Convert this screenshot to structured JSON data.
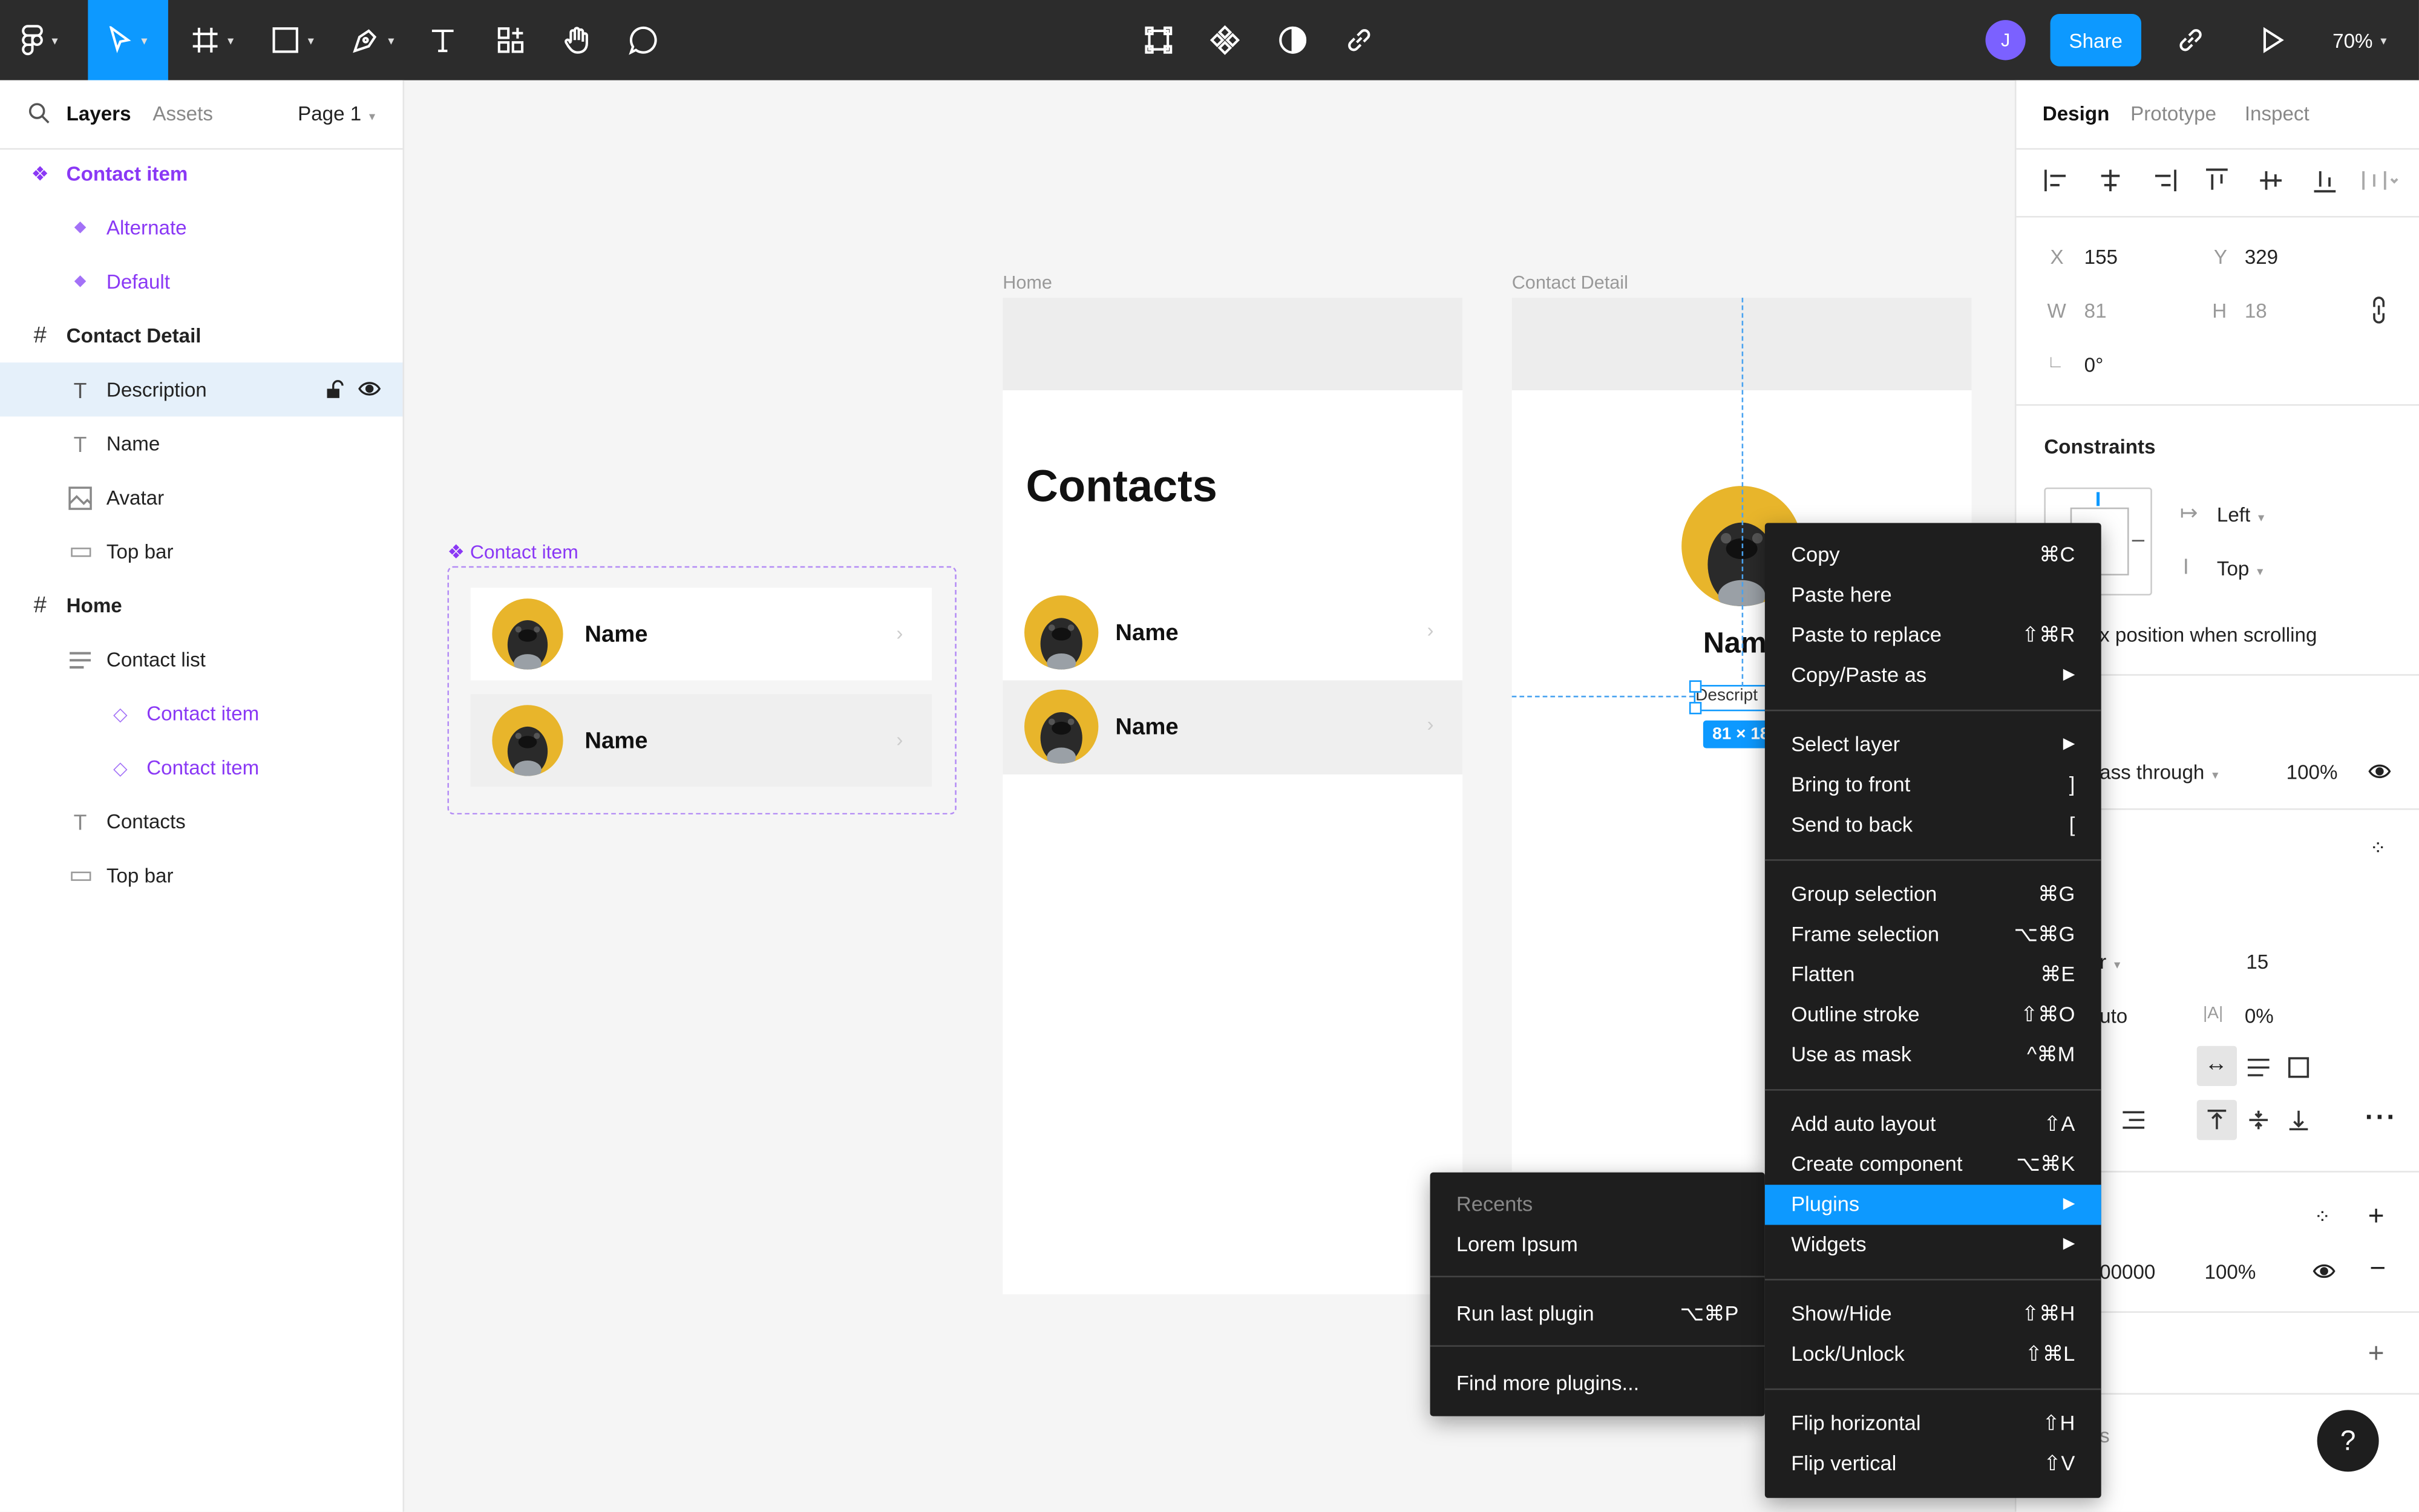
{
  "toolbar": {
    "share_label": "Share",
    "zoom": "70%",
    "avatar_initial": "J",
    "accent": "#0d99ff"
  },
  "left_panel": {
    "tabs": {
      "layers": "Layers",
      "assets": "Assets"
    },
    "page": "Page 1",
    "layers": [
      {
        "label": "Contact item",
        "icon": "component-icon"
      },
      {
        "label": "Alternate",
        "icon": "variant-icon"
      },
      {
        "label": "Default",
        "icon": "variant-icon"
      },
      {
        "label": "Contact Detail",
        "icon": "frame-icon"
      },
      {
        "label": "Description",
        "icon": "text-icon"
      },
      {
        "label": "Name",
        "icon": "text-icon"
      },
      {
        "label": "Avatar",
        "icon": "image-icon"
      },
      {
        "label": "Top bar",
        "icon": "rectangle-icon"
      },
      {
        "label": "Home",
        "icon": "frame-icon"
      },
      {
        "label": "Contact list",
        "icon": "auto-layout-icon"
      },
      {
        "label": "Contact item",
        "icon": "instance-icon"
      },
      {
        "label": "Contact item",
        "icon": "instance-icon"
      },
      {
        "label": "Contacts",
        "icon": "text-icon"
      },
      {
        "label": "Top bar",
        "icon": "rectangle-icon"
      }
    ]
  },
  "canvas": {
    "component_label": "Contact item",
    "home_label": "Home",
    "detail_label": "Contact Detail",
    "contacts_title": "Contacts",
    "row_name": "Name",
    "detail_name": "Name",
    "detail_desc": "Descript",
    "size_badge": "81 × 18"
  },
  "right_panel": {
    "tabs": {
      "design": "Design",
      "prototype": "Prototype",
      "inspect": "Inspect"
    },
    "x_label": "X",
    "x": "155",
    "y_label": "Y",
    "y": "329",
    "w_label": "W",
    "w": "81",
    "h_label": "H",
    "h": "18",
    "rotation": "0°",
    "constraints_title": "Constraints",
    "constraint_h": "Left",
    "constraint_v": "Top",
    "fix_position": "x position when scrolling",
    "blend": "ass through",
    "layer_opacity": "100%",
    "font_size": "15",
    "line_height": "uto",
    "letter_spacing_label": "|A|",
    "letter_spacing": "0%",
    "fill_hex": "00000",
    "fill_opacity": "100%",
    "effects_partial": "s",
    "font_weight_partial": "r"
  },
  "context_menu": {
    "items": [
      {
        "label": "Copy",
        "shortcut": "⌘C"
      },
      {
        "label": "Paste here",
        "shortcut": ""
      },
      {
        "label": "Paste to replace",
        "shortcut": "⇧⌘R"
      },
      {
        "label": "Copy/Paste as",
        "shortcut": "▶"
      },
      {
        "label": "Select layer",
        "shortcut": "▶"
      },
      {
        "label": "Bring to front",
        "shortcut": "]"
      },
      {
        "label": "Send to back",
        "shortcut": "["
      },
      {
        "label": "Group selection",
        "shortcut": "⌘G"
      },
      {
        "label": "Frame selection",
        "shortcut": "⌥⌘G"
      },
      {
        "label": "Flatten",
        "shortcut": "⌘E"
      },
      {
        "label": "Outline stroke",
        "shortcut": "⇧⌘O"
      },
      {
        "label": "Use as mask",
        "shortcut": "^⌘M"
      },
      {
        "label": "Add auto layout",
        "shortcut": "⇧A"
      },
      {
        "label": "Create component",
        "shortcut": "⌥⌘K"
      },
      {
        "label": "Plugins",
        "shortcut": "▶"
      },
      {
        "label": "Widgets",
        "shortcut": "▶"
      },
      {
        "label": "Show/Hide",
        "shortcut": "⇧⌘H"
      },
      {
        "label": "Lock/Unlock",
        "shortcut": "⇧⌘L"
      },
      {
        "label": "Flip horizontal",
        "shortcut": "⇧H"
      },
      {
        "label": "Flip vertical",
        "shortcut": "⇧V"
      }
    ]
  },
  "plugins_menu": {
    "recents": "Recents",
    "lorem": "Lorem Ipsum",
    "run_last": "Run last plugin",
    "run_last_shortcut": "⌥⌘P",
    "find_more": "Find more plugins..."
  },
  "help": "?"
}
